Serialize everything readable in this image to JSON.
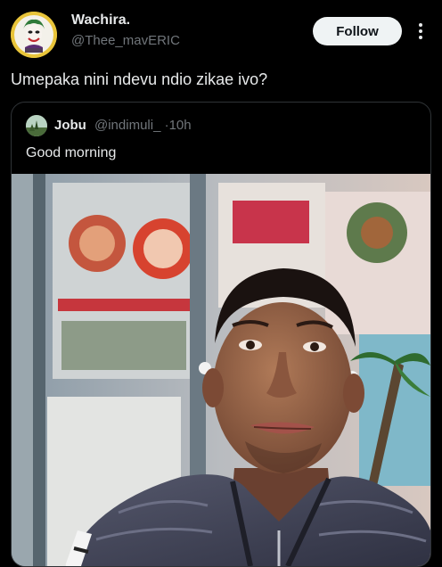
{
  "tweet": {
    "author": {
      "display_name": "Wachira.",
      "handle": "@Thee_mavERIC"
    },
    "follow_label": "Follow",
    "text": "Umepaka nini ndevu ndio zikae ivo?"
  },
  "quote": {
    "author": {
      "display_name": "Jobu",
      "handle": "@indimuli_",
      "separator": "·",
      "time": "10h"
    },
    "text": "Good morning"
  },
  "icons": {
    "more": "more-vertical-icon",
    "avatar": "joker-avatar",
    "quote_avatar": "landscape-avatar"
  },
  "colors": {
    "background": "#000000",
    "text_primary": "#e7e9ea",
    "text_secondary": "#71767b",
    "follow_bg": "#eff3f4",
    "card_border": "#2f3336"
  }
}
